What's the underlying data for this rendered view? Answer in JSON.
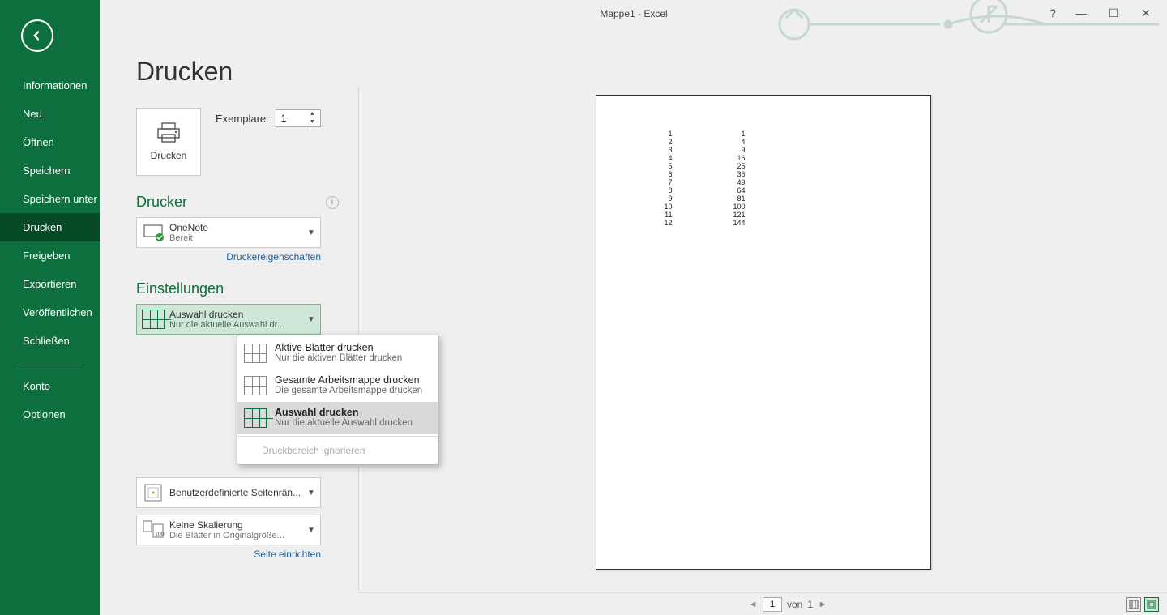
{
  "window": {
    "title": "Mappe1 - Excel"
  },
  "sidebar": {
    "items": [
      {
        "label": "Informationen"
      },
      {
        "label": "Neu"
      },
      {
        "label": "Öffnen"
      },
      {
        "label": "Speichern"
      },
      {
        "label": "Speichern unter"
      },
      {
        "label": "Drucken"
      },
      {
        "label": "Freigeben"
      },
      {
        "label": "Exportieren"
      },
      {
        "label": "Veröffentlichen"
      },
      {
        "label": "Schließen"
      },
      {
        "label": "Konto"
      },
      {
        "label": "Optionen"
      }
    ],
    "active_index": 5
  },
  "main": {
    "title": "Drucken",
    "print_button": "Drucken",
    "copies_label": "Exemplare:",
    "copies_value": "1",
    "printer_heading": "Drucker",
    "printer": {
      "name": "OneNote",
      "status": "Bereit"
    },
    "printer_properties": "Druckereigenschaften",
    "settings_heading": "Einstellungen",
    "scope": {
      "title": "Auswahl drucken",
      "sub": "Nur die aktuelle Auswahl dr..."
    },
    "scope_options": [
      {
        "title": "Aktive Blätter drucken",
        "sub": "Nur die aktiven Blätter drucken"
      },
      {
        "title": "Gesamte Arbeitsmappe drucken",
        "sub": "Die gesamte Arbeitsmappe drucken"
      },
      {
        "title": "Auswahl drucken",
        "sub": "Nur die aktuelle Auswahl drucken"
      }
    ],
    "scope_ignore": "Druckbereich ignorieren",
    "margins": "Benutzerdefinierte Seitenrän...",
    "scaling": {
      "title": "Keine Skalierung",
      "sub": "Die Blätter in Originalgröße..."
    },
    "page_setup": "Seite einrichten"
  },
  "pager": {
    "current": "1",
    "of_label": "von",
    "total": "1"
  },
  "preview_rows": [
    {
      "a": "1",
      "b": "1"
    },
    {
      "a": "2",
      "b": "4"
    },
    {
      "a": "3",
      "b": "9"
    },
    {
      "a": "4",
      "b": "16"
    },
    {
      "a": "5",
      "b": "25"
    },
    {
      "a": "6",
      "b": "36"
    },
    {
      "a": "7",
      "b": "49"
    },
    {
      "a": "8",
      "b": "64"
    },
    {
      "a": "9",
      "b": "81"
    },
    {
      "a": "10",
      "b": "100"
    },
    {
      "a": "11",
      "b": "121"
    },
    {
      "a": "12",
      "b": "144"
    }
  ]
}
